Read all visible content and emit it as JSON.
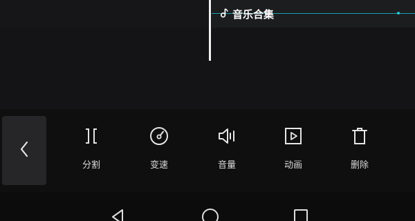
{
  "timeline": {
    "music_track_label": "音乐合集"
  },
  "toolbar": {
    "back_icon": "chevron-left-icon",
    "tools": [
      {
        "label": "分割",
        "icon": "split-icon"
      },
      {
        "label": "变速",
        "icon": "speed-dial-icon"
      },
      {
        "label": "音量",
        "icon": "volume-icon"
      },
      {
        "label": "动画",
        "icon": "animation-play-icon"
      },
      {
        "label": "删除",
        "icon": "trash-icon"
      }
    ]
  },
  "system_nav": {
    "buttons": [
      "back-triangle-icon",
      "home-circle-icon",
      "recents-square-icon"
    ]
  },
  "colors": {
    "accent_line": "#1fb4c4",
    "background": "#121214",
    "text": "#d8d8d8"
  }
}
